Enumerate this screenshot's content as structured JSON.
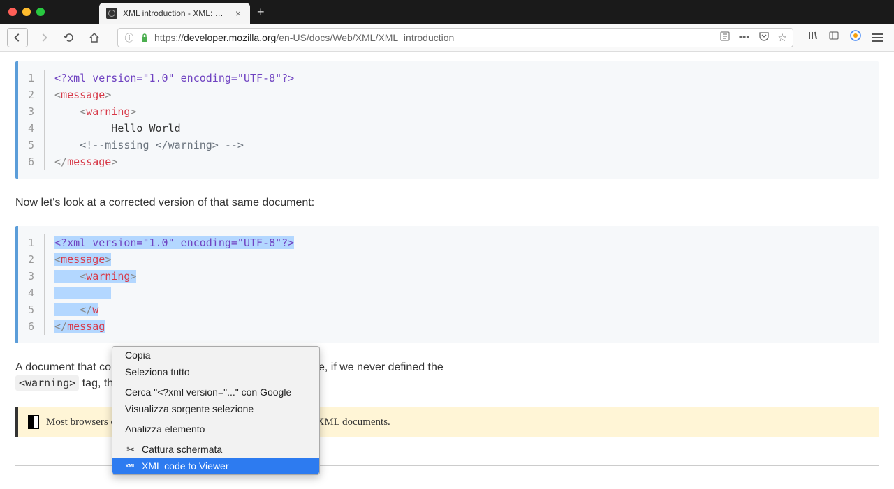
{
  "window": {
    "tab_title": "XML introduction - XML: Extens"
  },
  "addressbar": {
    "url_prefix": "https://",
    "domain": "developer.mozilla.org",
    "path": "/en-US/docs/Web/XML/XML_introduction"
  },
  "code1": {
    "lines": [
      "1",
      "2",
      "3",
      "4",
      "5",
      "6"
    ],
    "l1_pi": "<?xml version=\"1.0\" encoding=\"UTF-8\"?>",
    "l2_open": "<",
    "l2_tag": "message",
    "l2_close": ">",
    "l3_indent": "    ",
    "l3_open": "<",
    "l3_tag": "warning",
    "l3_close": ">",
    "l4_text": "         Hello World",
    "l5_indent": "    ",
    "l5_comment": "<!--missing </warning> -->",
    "l6_open": "</",
    "l6_tag": "message",
    "l6_close": ">"
  },
  "para1": "Now let's look at a corrected version of that same document:",
  "code2": {
    "lines": [
      "1",
      "2",
      "3",
      "4",
      "5",
      "6"
    ],
    "l1_pi": "<?xml version=\"1.0\" encoding=\"UTF-8\"?>",
    "l2_open": "<",
    "l2_tag": "message",
    "l2_close": ">",
    "l3_indent": "    ",
    "l3_open": "<",
    "l3_tag": "warning",
    "l3_close": ">",
    "l4_text": "         ",
    "l5_indent": "    ",
    "l5_open": "</",
    "l5_tag": "w",
    "l6_open": "</",
    "l6_tag": "messag"
  },
  "para2_a": "A document that co",
  "para2_b": "mple, if we never defined the ",
  "para2_code": "<warning>",
  "para2_c": " tag, th",
  "note": "Most browsers offer a debugger that can identify poorly-formed XML documents.",
  "contextmenu": {
    "copy": "Copia",
    "selectall": "Seleziona tutto",
    "search": "Cerca \"<?xml version=\"...\" con Google",
    "viewsource": "Visualizza sorgente selezione",
    "inspect": "Analizza elemento",
    "screenshot": "Cattura schermata",
    "xmlviewer": "XML code to Viewer"
  }
}
